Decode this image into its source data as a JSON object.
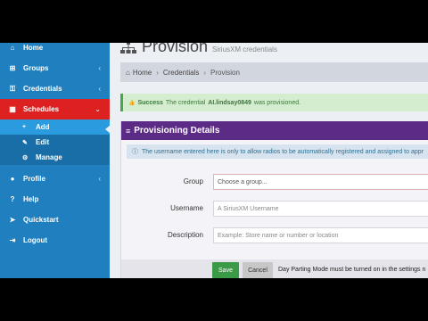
{
  "sidebar": {
    "items": [
      {
        "label": "Home",
        "icon": "home-icon",
        "glyph": "⌂",
        "chevron": ""
      },
      {
        "label": "Groups",
        "icon": "sitemap-icon",
        "glyph": "⊞",
        "chevron": "‹"
      },
      {
        "label": "Credentials",
        "icon": "key-icon",
        "glyph": "⚿",
        "chevron": "‹"
      },
      {
        "label": "Schedules",
        "icon": "calendar-icon",
        "glyph": "▦",
        "chevron": "⌄"
      }
    ],
    "sub_items": [
      {
        "label": "Add",
        "icon": "plus-icon",
        "glyph": "+"
      },
      {
        "label": "Edit",
        "icon": "pencil-icon",
        "glyph": "✎"
      },
      {
        "label": "Manage",
        "icon": "cogs-icon",
        "glyph": "⚙"
      }
    ],
    "bottom_items": [
      {
        "label": "Profile",
        "icon": "user-icon",
        "glyph": "●",
        "chevron": "‹"
      },
      {
        "label": "Help",
        "icon": "question-icon",
        "glyph": "?",
        "chevron": ""
      },
      {
        "label": "Quickstart",
        "icon": "paper-plane-icon",
        "glyph": "➤",
        "chevron": ""
      },
      {
        "label": "Logout",
        "icon": "sign-out-icon",
        "glyph": "⇥",
        "chevron": ""
      }
    ]
  },
  "header": {
    "title": "Provision",
    "subtitle": "SiriusXM credentials"
  },
  "breadcrumb": {
    "home": "Home",
    "credentials": "Credentials",
    "current": "Provision",
    "home_glyph": "⌂",
    "sep": "›"
  },
  "alert": {
    "glyph": "👍",
    "label": "Success",
    "prefix": "The credential",
    "name": "AI.lindsay0849",
    "suffix": "was provisioned."
  },
  "panel": {
    "title": "Provisioning Details",
    "title_glyph": "≡",
    "info_glyph": "ⓘ",
    "info": "The username entered here is only to allow radios to be automatically registered and assigned to appr",
    "fields": {
      "group": {
        "label": "Group",
        "value": "Choose a group..."
      },
      "username": {
        "label": "Username",
        "placeholder": "A SiriusXM Username"
      },
      "description": {
        "label": "Description",
        "placeholder": "Example: Store name or number or location"
      }
    },
    "save_label": "Save",
    "cancel_label": "Cancel",
    "note": "Day Parting Mode must be turned on in the settings n"
  },
  "colors": {
    "sidebar": "#1f7fbf",
    "active": "#dd2020",
    "sub_active": "#2b9be0",
    "panel_header": "#5c2b86",
    "save": "#3a9a45"
  }
}
